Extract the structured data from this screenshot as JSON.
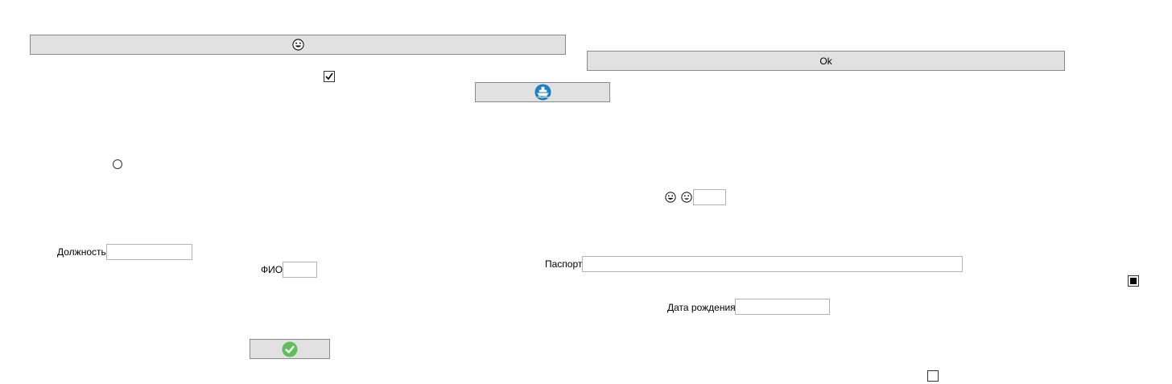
{
  "buttons": {
    "smiley_button": {
      "icon": "grinning-face-icon"
    },
    "ok_button": {
      "label": "Ok"
    },
    "ship_button": {
      "icon": "ship-icon",
      "icon_color": "#1f7fc4"
    },
    "confirm_button": {
      "icon": "green-checkmark-icon",
      "icon_color": "#5cbf58"
    }
  },
  "checkboxes": {
    "top_checkbox": {
      "checked": true
    },
    "indeterminate_checkbox": {
      "state": "indeterminate"
    },
    "bottom_checkbox": {
      "checked": false
    }
  },
  "radio": {
    "selected": false
  },
  "emoji_icons": [
    "grinning-face-icon",
    "smiling-face-icon"
  ],
  "fields": {
    "position": {
      "label": "Должность",
      "value": ""
    },
    "full_name": {
      "label": "ФИО",
      "value": ""
    },
    "passport": {
      "label": "Паспорт",
      "value": ""
    },
    "birth_date": {
      "label": "Дата рождения",
      "value": ""
    },
    "small_input": {
      "value": ""
    }
  }
}
